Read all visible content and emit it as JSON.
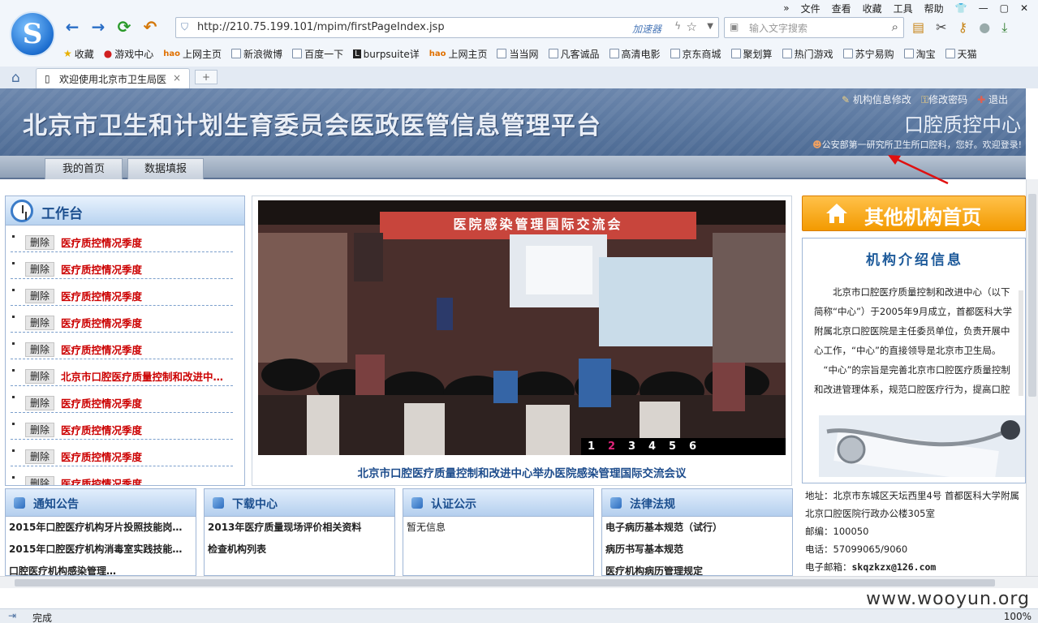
{
  "browser": {
    "menus": [
      "»",
      "文件",
      "查看",
      "收藏",
      "工具",
      "帮助"
    ],
    "url": "http://210.75.199.101/mpim/firstPageIndex.jsp",
    "accelerator": "加速器",
    "search_placeholder": "输入文字搜索",
    "bookmarks": [
      "收藏",
      "游戏中心",
      "上网主页",
      "新浪微博",
      "百度一下",
      "burpsuite详",
      "上网主页",
      "当当网",
      "凡客诚品",
      "高清电影",
      "京东商城",
      "聚划算",
      "热门游戏",
      "苏宁易购",
      "淘宝",
      "天猫"
    ],
    "tab_title": "欢迎使用北京市卫生局医",
    "tab_add": "+",
    "status": "完成",
    "zoom": "100%",
    "watermark": "www.wooyun.org"
  },
  "header": {
    "title": "北京市卫生和计划生育委员会医政医管信息管理平台",
    "center_name": "口腔质控中心",
    "links": [
      "机构信息修改",
      "修改密码",
      "退出"
    ],
    "welcome": "公安部第一研究所卫生所口腔科，您好。欢迎登录!"
  },
  "nav": {
    "tabs": [
      "我的首页",
      "数据填报"
    ]
  },
  "workbench": {
    "title": "工作台",
    "delete_label": "删除",
    "items": [
      "医疗质控情况季度",
      "医疗质控情况季度",
      "医疗质控情况季度",
      "医疗质控情况季度",
      "医疗质控情况季度",
      "北京市口腔医疗质量控制和改进中…",
      "医疗质控情况季度",
      "医疗质控情况季度",
      "医疗质控情况季度",
      "医疗质控情况季度"
    ]
  },
  "slideshow": {
    "caption": "北京市口腔医疗质量控制和改进中心举办医院感染管理国际交流会议",
    "banner_text": "医院感染管理国际交流会",
    "pages": [
      "1",
      "2",
      "3",
      "4",
      "5",
      "6"
    ],
    "active_page": "2"
  },
  "right": {
    "other_button": "其他机构首页",
    "intro_title": "机构介绍信息",
    "intro_p1": "北京市口腔医疗质量控制和改进中心（以下简称“中心”）于2005年9月成立，首都医科大学附属北京口腔医院是主任委员单位，负责开展中心工作，“中心”的直接领导是北京市卫生局。",
    "intro_p2": "“中心”的宗旨是完善北京市口腔医疗质量控制和改进管理体系，规范口腔医疗行为，提高口腔",
    "contact": {
      "address": "地址：北京市东城区天坛西里4号 首都医科大学附属北京口腔医院行政办公楼305室",
      "postcode": "邮编：100050",
      "phone": "电话：57099065/9060",
      "email_label": "电子邮箱：",
      "email": "skqzkzx@126.com"
    }
  },
  "panels": [
    {
      "title": "通知公告",
      "items": [
        "2015年口腔医疗机构牙片投照技能岗…",
        "2015年口腔医疗机构消毒室实践技能…",
        "口腔医疗机构感染管理…"
      ]
    },
    {
      "title": "下载中心",
      "items": [
        "2013年医疗质量现场评价相关资料",
        "检查机构列表"
      ]
    },
    {
      "title": "认证公示",
      "items": [
        "暂无信息"
      ]
    },
    {
      "title": "法律法规",
      "items": [
        "电子病历基本规范（试行）",
        "病历书写基本规范",
        "医疗机构病历管理规定"
      ]
    }
  ],
  "colors": {
    "accent": "#1c4f8f",
    "alert": "#cc0000",
    "orange": "#f39a00"
  }
}
